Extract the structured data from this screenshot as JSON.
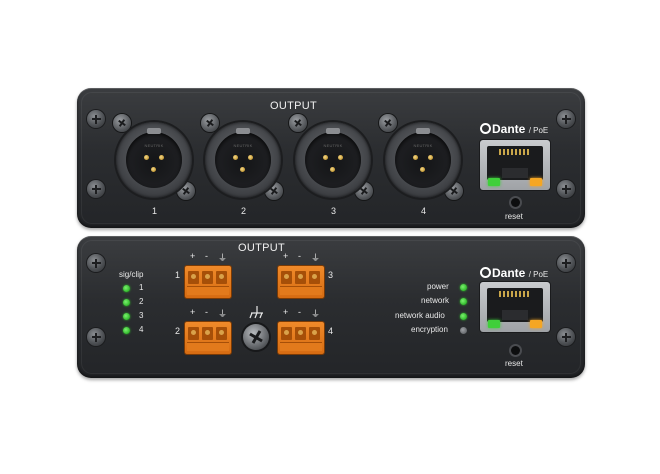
{
  "top_panel": {
    "title": "OUTPUT",
    "channels": [
      "1",
      "2",
      "3",
      "4"
    ],
    "dante_label": "Dante",
    "poe_label": "/ PoE",
    "reset_label": "reset",
    "xlr_brand": "NEUTRIK"
  },
  "bottom_panel": {
    "title": "OUTPUT",
    "sigclip_label": "sig/clip",
    "sigclip_channels": [
      "1",
      "2",
      "3",
      "4"
    ],
    "terminal_polarity": [
      "+",
      "-",
      "⏚"
    ],
    "terminal_channels": [
      "1",
      "2",
      "3",
      "4"
    ],
    "dante_label": "Dante",
    "poe_label": "/ PoE",
    "reset_label": "reset",
    "status_leds": [
      {
        "label": "power",
        "state": "on",
        "color": "#2fb82a"
      },
      {
        "label": "network",
        "state": "on",
        "color": "#2fb82a"
      },
      {
        "label": "network audio",
        "state": "on",
        "color": "#2fb82a"
      },
      {
        "label": "encryption",
        "state": "off",
        "color": "#6e7175"
      }
    ]
  },
  "colors": {
    "chassis": "#2b2d30",
    "terminal": "#e27a1c",
    "led_green": "#3fcf3a",
    "led_amber": "#f5a623",
    "xlr_pin": "#c59a35"
  }
}
